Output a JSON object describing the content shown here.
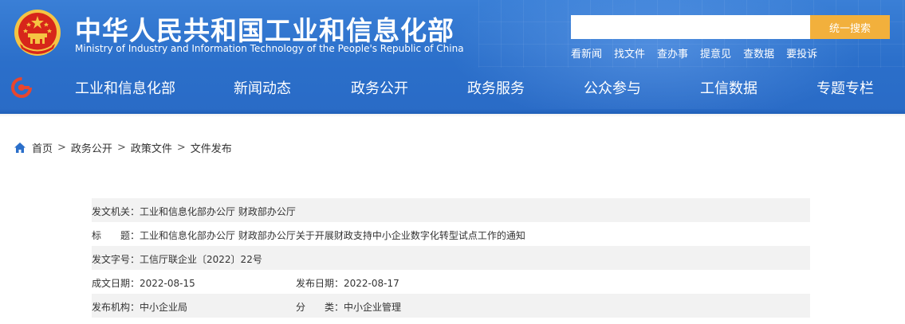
{
  "header": {
    "title": "中华人民共和国工业和信息化部",
    "subtitle": "Ministry of Industry and Information Technology of the People's Republic of China",
    "search": {
      "placeholder": "",
      "button_label": "统一搜索"
    },
    "quick_links": [
      "看新闻",
      "找文件",
      "查办事",
      "提意见",
      "查数据",
      "要投诉"
    ],
    "colors": {
      "header_blue": "#2b6fca",
      "search_button": "#f2b03c",
      "emblem_red": "#d7261a",
      "emblem_gold": "#f5c443"
    }
  },
  "nav": {
    "items": [
      "工业和信息化部",
      "新闻动态",
      "政务公开",
      "政务服务",
      "公众参与",
      "工信数据",
      "专题专栏"
    ]
  },
  "breadcrumb": {
    "items": [
      "首页",
      "政务公开",
      "政策文件",
      "文件发布"
    ],
    "separator": ">"
  },
  "document": {
    "issuer_label": "发文机关：",
    "issuer": "工业和信息化部办公厅 财政部办公厅",
    "title_label": "标　　题：",
    "title": "工业和信息化部办公厅 财政部办公厅关于开展财政支持中小企业数字化转型试点工作的通知",
    "doc_number_label": "发文字号：",
    "doc_number": "工信厅联企业〔2022〕22号",
    "created_label": "成文日期：",
    "created_date": "2022-08-15",
    "published_label": "发布日期：",
    "published_date": "2022-08-17",
    "agency_label": "发布机构：",
    "agency": "中小企业局",
    "category_label": "分　　类：",
    "category": "中小企业管理"
  }
}
